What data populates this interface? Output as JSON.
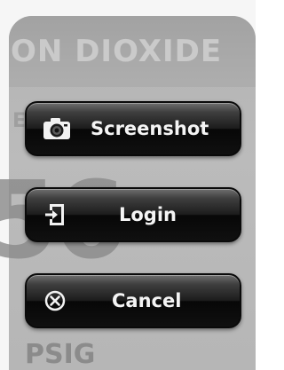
{
  "background": {
    "title": "ON DIOXIDE",
    "subtitle_fragment": "E",
    "big_value_fragment": "56",
    "unit": "PSIG"
  },
  "menu": {
    "items": [
      {
        "label": "Screenshot",
        "icon": "camera-icon"
      },
      {
        "label": "Login",
        "icon": "login-icon"
      },
      {
        "label": "Cancel",
        "icon": "cancel-icon"
      }
    ]
  },
  "colors": {
    "button_top": "#6f6f6f",
    "button_bottom": "#070707",
    "button_text": "#f4f4f4",
    "background_panel": "#bdbdbd"
  }
}
